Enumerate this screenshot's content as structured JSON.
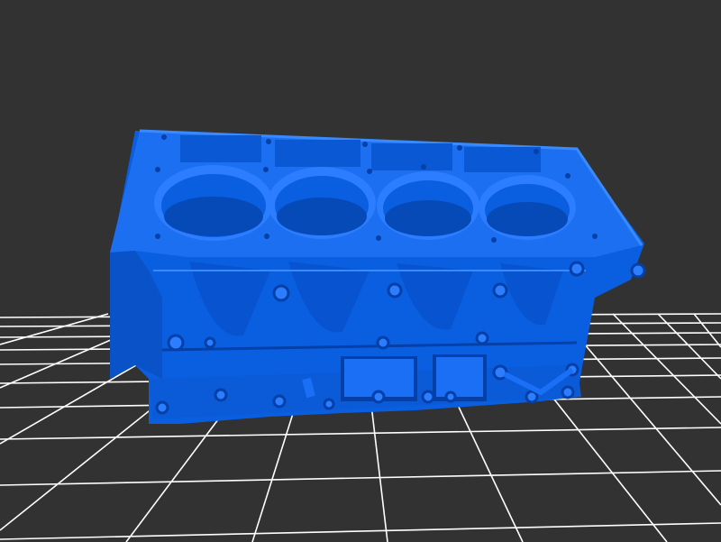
{
  "viewer": {
    "background_color": "#323232",
    "grid_color": "#ffffff",
    "model_color": "#0a5fe0",
    "model_highlight": "#2a7dff",
    "model_shadow": "#0440a8",
    "model_dark": "#03307e",
    "model": "engine-block",
    "cylinders": 4,
    "grid_visible": true
  }
}
